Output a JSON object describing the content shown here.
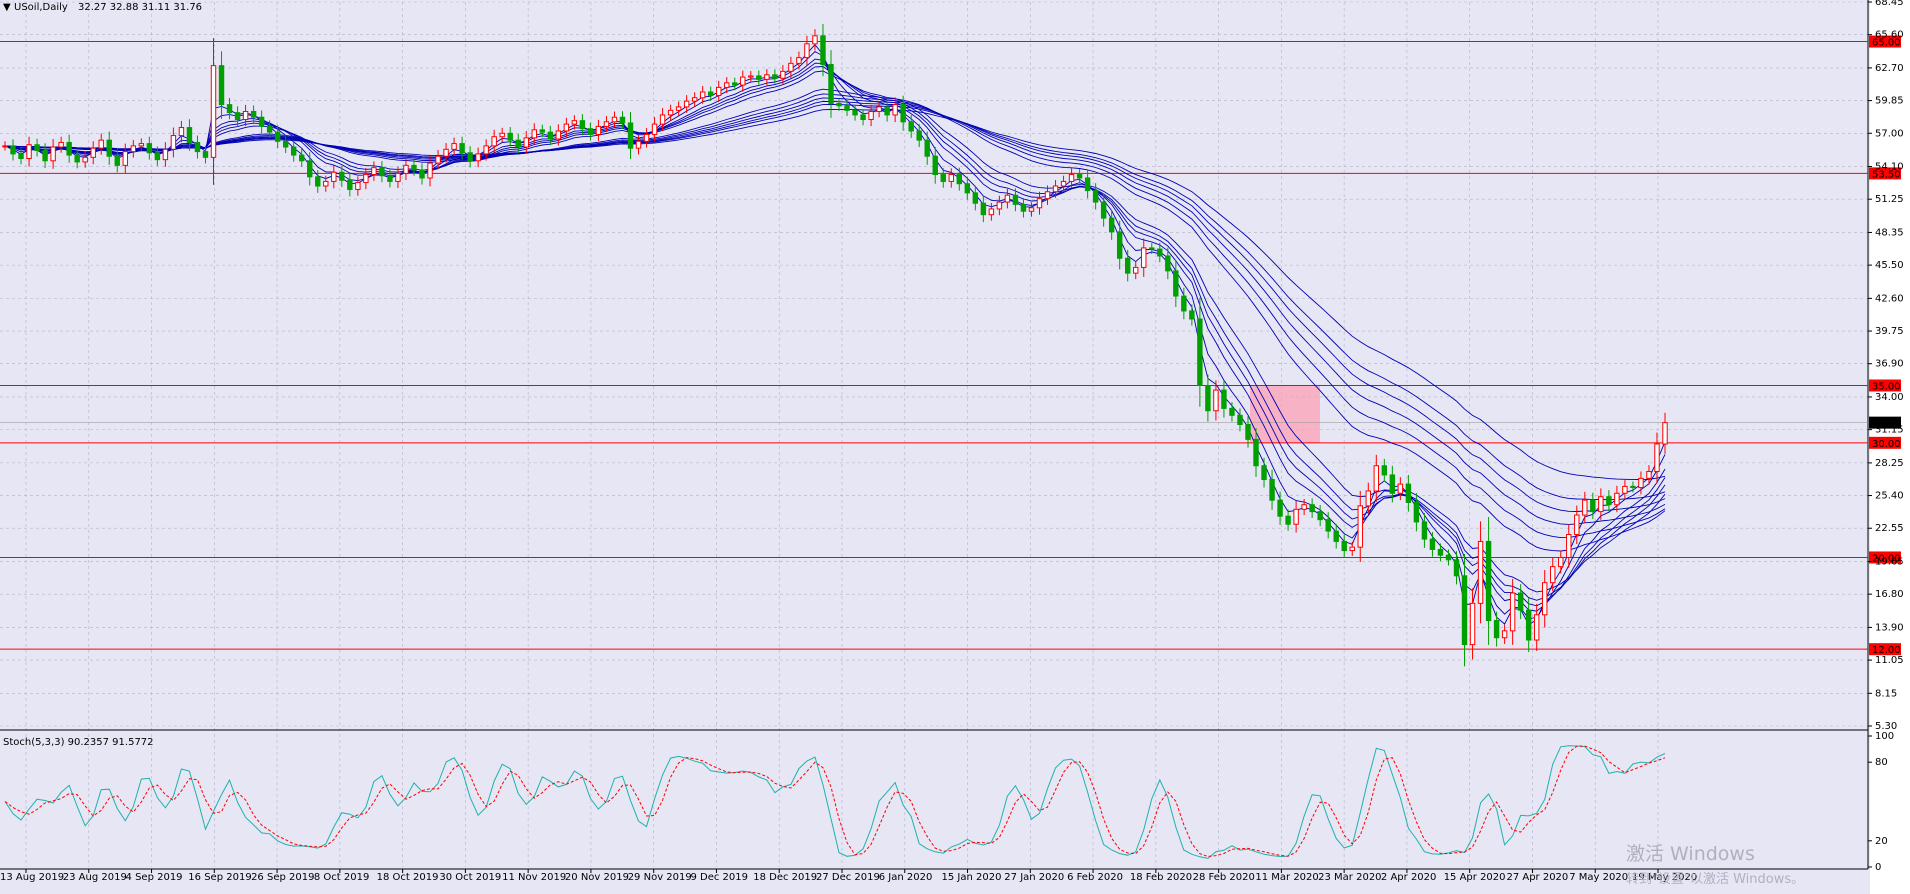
{
  "header": {
    "symbol_text": "USoil,Daily",
    "ohlc_text": "32.27 32.88 31.11 31.76"
  },
  "indicator": {
    "label": "Stoch(5,3,3) 90.2357 91.5772"
  },
  "watermark": {
    "line1": "激活 Windows",
    "line2": "转到\"设置\"以激活 Windows。"
  },
  "colors": {
    "background": "#e6e6f5",
    "grid": "#b4b4c8",
    "bull": "#ff0000",
    "bear": "#00a000",
    "gmma": "#0000b4",
    "level_line": "#ff0000",
    "level_tag": "#ff0000",
    "stoch_main": "#20b2aa",
    "stoch_signal": "#ff0000",
    "last_price_tag": "#000000"
  },
  "chart_data": {
    "type": "candlestick",
    "title": "USoil,Daily",
    "price_axis_ticks": [
      "68.45",
      "65.60",
      "62.70",
      "59.85",
      "57.00",
      "54.10",
      "51.25",
      "48.35",
      "45.50",
      "42.60",
      "39.75",
      "36.90",
      "34.00",
      "31.15",
      "28.25",
      "25.40",
      "22.55",
      "19.65",
      "16.80",
      "13.90",
      "11.05",
      "8.15",
      "5.30"
    ],
    "ylim": [
      5.3,
      68.45
    ],
    "horizontal_levels": [
      65.0,
      53.5,
      35.0,
      30.0,
      20.0,
      12.0
    ],
    "level_labels": [
      "65.00",
      "53.50",
      "35.00",
      "30.00",
      "20.00",
      "12.00"
    ],
    "last_price": 31.76,
    "last_price_label": "31.76",
    "highlight_zone": {
      "from": "2 Mar 2020",
      "to": "9 Mar 2020",
      "low": 30.0,
      "high": 35.0
    },
    "date_labels": [
      "13 Aug 2019",
      "23 Aug 2019",
      "4 Sep 2019",
      "16 Sep 2019",
      "26 Sep 2019",
      "8 Oct 2019",
      "18 Oct 2019",
      "30 Oct 2019",
      "11 Nov 2019",
      "20 Nov 2019",
      "29 Nov 2019",
      "9 Dec 2019",
      "18 Dec 2019",
      "27 Dec 2019",
      "6 Jan 2020",
      "15 Jan 2020",
      "27 Jan 2020",
      "6 Feb 2020",
      "18 Feb 2020",
      "28 Feb 2020",
      "11 Mar 2020",
      "23 Mar 2020",
      "2 Apr 2020",
      "15 Apr 2020",
      "27 Apr 2020",
      "7 May 2020",
      "19 May 2020"
    ],
    "candle_closes": [
      55.9,
      55.2,
      54.8,
      56.0,
      55.5,
      54.6,
      55.8,
      56.2,
      55.1,
      54.5,
      54.9,
      55.7,
      56.4,
      55.0,
      54.2,
      55.4,
      55.9,
      56.1,
      55.3,
      54.7,
      55.6,
      56.8,
      57.5,
      56.2,
      55.4,
      54.9,
      62.9,
      59.5,
      58.8,
      58.2,
      58.9,
      58.4,
      57.6,
      57.1,
      56.3,
      55.8,
      55.1,
      54.6,
      53.2,
      52.4,
      52.8,
      53.6,
      52.9,
      52.1,
      52.7,
      53.4,
      54.0,
      53.3,
      52.8,
      53.5,
      54.2,
      53.8,
      53.1,
      54.4,
      55.0,
      55.6,
      56.1,
      55.3,
      54.6,
      55.2,
      55.9,
      56.7,
      57.0,
      56.4,
      55.8,
      56.6,
      57.3,
      57.1,
      56.5,
      57.2,
      57.8,
      58.1,
      57.4,
      56.9,
      57.6,
      58.0,
      58.4,
      57.9,
      55.7,
      56.3,
      56.9,
      57.8,
      58.6,
      59.0,
      59.3,
      59.8,
      60.1,
      60.6,
      60.3,
      61.0,
      61.4,
      61.2,
      61.9,
      62.0,
      61.7,
      62.1,
      61.8,
      62.4,
      63.1,
      63.6,
      64.8,
      65.5,
      63.0,
      59.6,
      59.4,
      59.0,
      58.6,
      58.2,
      58.9,
      59.3,
      58.6,
      59.5,
      58.0,
      57.2,
      56.4,
      55.0,
      53.4,
      52.8,
      53.4,
      52.6,
      51.8,
      50.9,
      49.9,
      50.4,
      51.0,
      51.6,
      50.8,
      50.2,
      50.5,
      51.3,
      51.9,
      52.4,
      52.8,
      53.4,
      53.1,
      52.0,
      51.0,
      49.6,
      48.4,
      46.1,
      44.8,
      45.3,
      47.0,
      46.9,
      46.3,
      45.0,
      42.8,
      41.5,
      40.8,
      35.0,
      32.8,
      34.6,
      33.0,
      32.4,
      31.6,
      30.3,
      28.0,
      26.8,
      25.0,
      23.6,
      22.9,
      24.2,
      24.6,
      24.0,
      23.3,
      22.3,
      21.4,
      20.6,
      20.9,
      24.5,
      25.8,
      28.0,
      27.2,
      25.6,
      26.4,
      24.8,
      23.1,
      21.6,
      20.7,
      20.2,
      19.8,
      18.4,
      12.4,
      16.0,
      21.4,
      14.5,
      13.0,
      13.6,
      16.9,
      15.4,
      12.8,
      15.0,
      17.8,
      19.2,
      20.0,
      22.0,
      23.7,
      25.0,
      24.0,
      25.3,
      24.6,
      25.6,
      26.2,
      26.1,
      26.9,
      27.5,
      29.9,
      31.76
    ],
    "gmma_periods": [
      3,
      5,
      8,
      10,
      12,
      15,
      30,
      35,
      40,
      45,
      50,
      60
    ],
    "stochastic": {
      "params": "Stoch(5,3,3)",
      "main": 90.2357,
      "signal": 91.5772,
      "levels": [
        0,
        20,
        80,
        100
      ],
      "level_labels": [
        "0",
        "20",
        "80",
        "100"
      ]
    }
  }
}
